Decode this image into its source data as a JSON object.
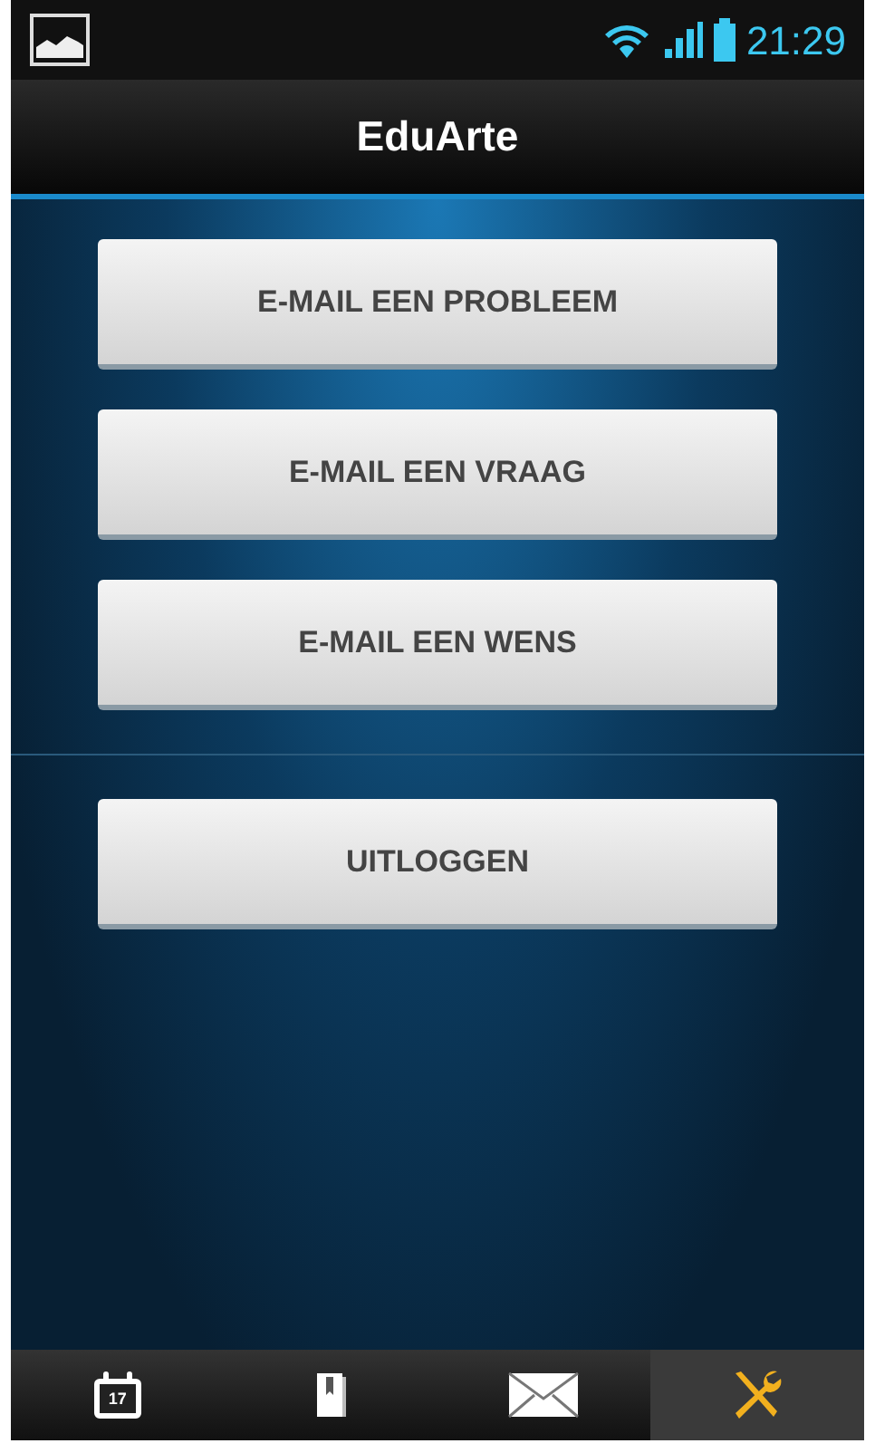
{
  "status_bar": {
    "time": "21:29"
  },
  "app_bar": {
    "title": "EduArte"
  },
  "button_groups": [
    [
      "E-MAIL EEN PROBLEEM",
      "E-MAIL EEN VRAAG",
      "E-MAIL EEN WENS"
    ],
    [
      "UITLOGGEN"
    ]
  ],
  "tabs": [
    {
      "kind": "calendar",
      "label": "17",
      "selected": false
    },
    {
      "kind": "book",
      "selected": false
    },
    {
      "kind": "mail",
      "selected": false
    },
    {
      "kind": "tools",
      "selected": true
    }
  ]
}
